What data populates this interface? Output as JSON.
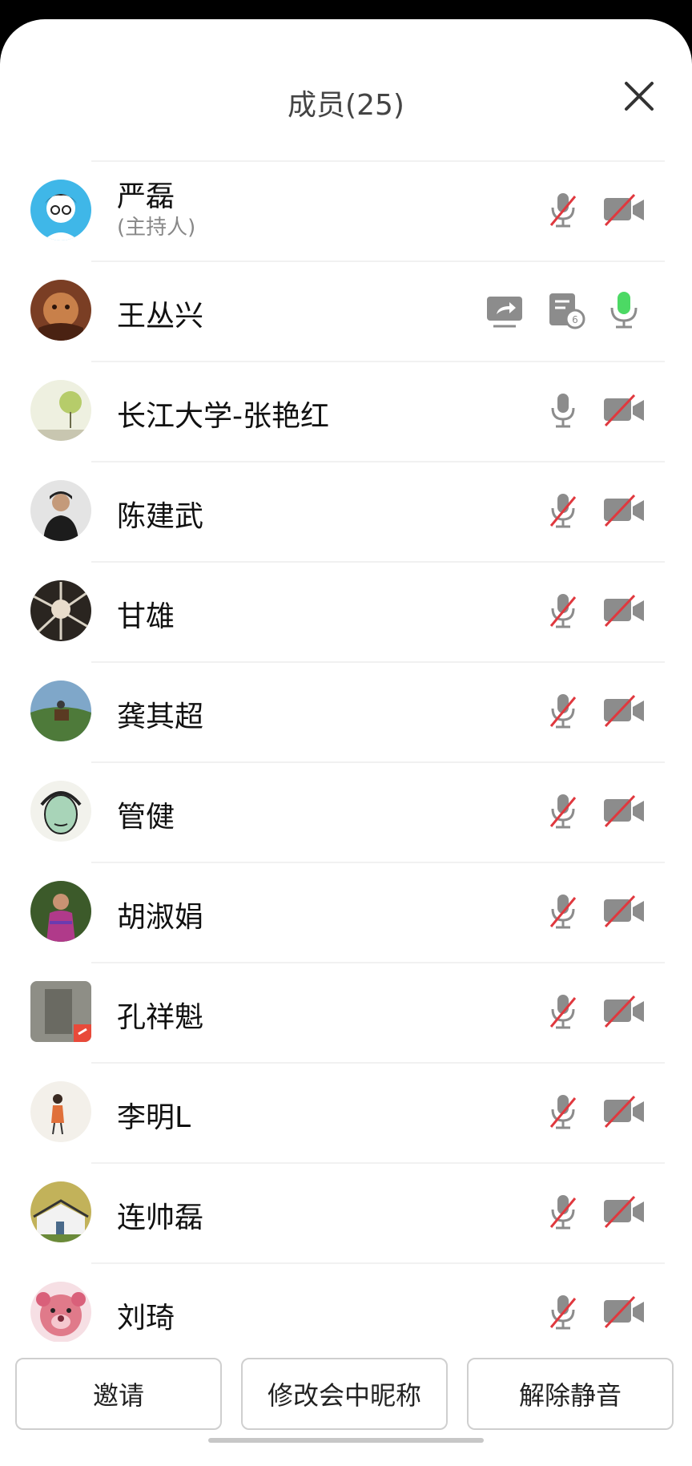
{
  "header": {
    "title": "成员(25)"
  },
  "members": [
    {
      "name": "严磊",
      "role": "(主持人)",
      "mic": "muted",
      "camera": "off"
    },
    {
      "name": "王丛兴",
      "role": "",
      "mic": "active",
      "camera": "off",
      "share": true,
      "notes": true
    },
    {
      "name": "长江大学-张艳红",
      "role": "",
      "mic": "on",
      "camera": "off"
    },
    {
      "name": "陈建武",
      "role": "",
      "mic": "muted",
      "camera": "off"
    },
    {
      "name": "甘雄",
      "role": "",
      "mic": "muted",
      "camera": "off"
    },
    {
      "name": "龚其超",
      "role": "",
      "mic": "muted",
      "camera": "off"
    },
    {
      "name": "管健",
      "role": "",
      "mic": "muted",
      "camera": "off"
    },
    {
      "name": "胡淑娟",
      "role": "",
      "mic": "muted",
      "camera": "off"
    },
    {
      "name": "孔祥魁",
      "role": "",
      "mic": "muted",
      "camera": "off"
    },
    {
      "name": "李明L",
      "role": "",
      "mic": "muted",
      "camera": "off"
    },
    {
      "name": "连帅磊",
      "role": "",
      "mic": "muted",
      "camera": "off"
    },
    {
      "name": "刘琦",
      "role": "",
      "mic": "muted",
      "camera": "off"
    }
  ],
  "footer": {
    "invite": "邀请",
    "rename": "修改会中昵称",
    "unmute": "解除静音"
  },
  "colors": {
    "muted_slash": "#e0383e",
    "mic_active": "#4cd964",
    "icon_gray": "#8c8c8c"
  }
}
